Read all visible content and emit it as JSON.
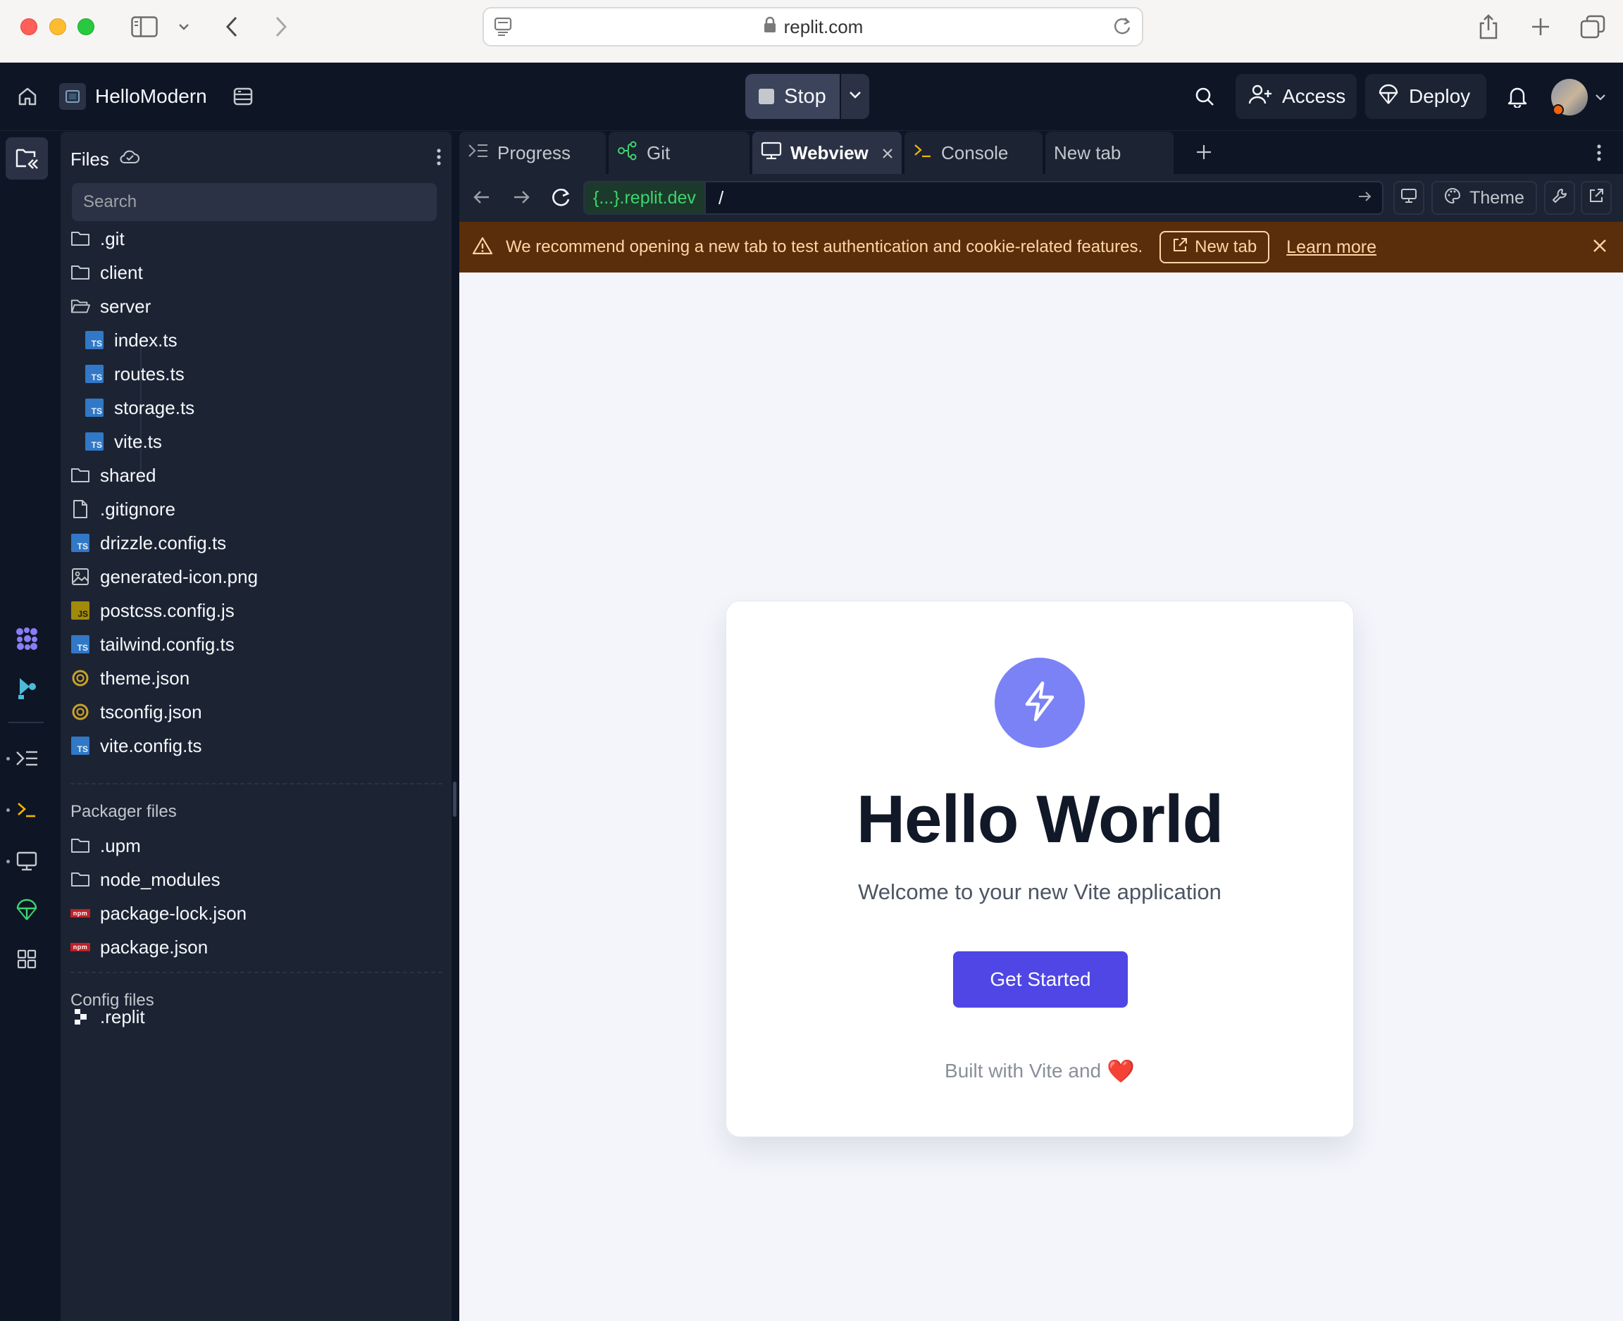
{
  "browser": {
    "url": "replit.com"
  },
  "topbar": {
    "project_name": "HelloModern",
    "stop_label": "Stop",
    "access_label": "Access",
    "deploy_label": "Deploy"
  },
  "files_panel": {
    "title": "Files",
    "search_placeholder": "Search",
    "items": [
      {
        "name": ".git",
        "icon": "folder-icon"
      },
      {
        "name": "client",
        "icon": "folder-icon"
      },
      {
        "name": "server",
        "icon": "folder-open-icon"
      },
      {
        "name": "index.ts",
        "icon": "typescript-file-icon"
      },
      {
        "name": "routes.ts",
        "icon": "typescript-file-icon"
      },
      {
        "name": "storage.ts",
        "icon": "typescript-file-icon"
      },
      {
        "name": "vite.ts",
        "icon": "typescript-file-icon"
      },
      {
        "name": "shared",
        "icon": "folder-icon"
      },
      {
        "name": ".gitignore",
        "icon": "file-icon"
      },
      {
        "name": "drizzle.config.ts",
        "icon": "typescript-file-icon"
      },
      {
        "name": "generated-icon.png",
        "icon": "image-file-icon"
      },
      {
        "name": "postcss.config.js",
        "icon": "javascript-file-icon"
      },
      {
        "name": "tailwind.config.ts",
        "icon": "typescript-file-icon"
      },
      {
        "name": "theme.json",
        "icon": "json-file-icon"
      },
      {
        "name": "tsconfig.json",
        "icon": "json-file-icon"
      },
      {
        "name": "vite.config.ts",
        "icon": "typescript-file-icon"
      }
    ],
    "packager_title": "Packager files",
    "packager_items": [
      {
        "name": ".upm",
        "icon": "folder-icon"
      },
      {
        "name": "node_modules",
        "icon": "folder-icon"
      },
      {
        "name": "package-lock.json",
        "icon": "npm-file-icon"
      },
      {
        "name": "package.json",
        "icon": "npm-file-icon"
      }
    ],
    "config_title": "Config files",
    "config_items": [
      {
        "name": ".replit",
        "icon": "replit-file-icon"
      }
    ],
    "ts_badge": "TS",
    "js_badge": "JS",
    "npm_badge": "npm"
  },
  "tabs": [
    {
      "label": "Progress",
      "icon": "progress-icon"
    },
    {
      "label": "Git",
      "icon": "git-icon"
    },
    {
      "label": "Webview",
      "icon": "monitor-icon",
      "active": true
    },
    {
      "label": "Console",
      "icon": "terminal-icon"
    },
    {
      "label": "New tab",
      "icon": ""
    }
  ],
  "webview": {
    "domain": "{...}.replit.dev",
    "path": "/",
    "theme_label": "Theme"
  },
  "banner": {
    "message": "We recommend opening a new tab to test authentication and cookie-related features.",
    "new_tab_label": "New tab",
    "learn_more_label": "Learn more"
  },
  "preview": {
    "title": "Hello World",
    "subtitle": "Welcome to your new Vite application",
    "cta_label": "Get Started",
    "footer_text": "Built with Vite and",
    "footer_emoji": "❤️"
  },
  "colors": {
    "bg_dark": "#0e1525",
    "panel": "#1c2333",
    "accent_indigo": "#4f46e5",
    "logo_circle": "#7b82f5",
    "banner_bg": "#5a2e0a",
    "domain_green": "#3fd46e"
  }
}
